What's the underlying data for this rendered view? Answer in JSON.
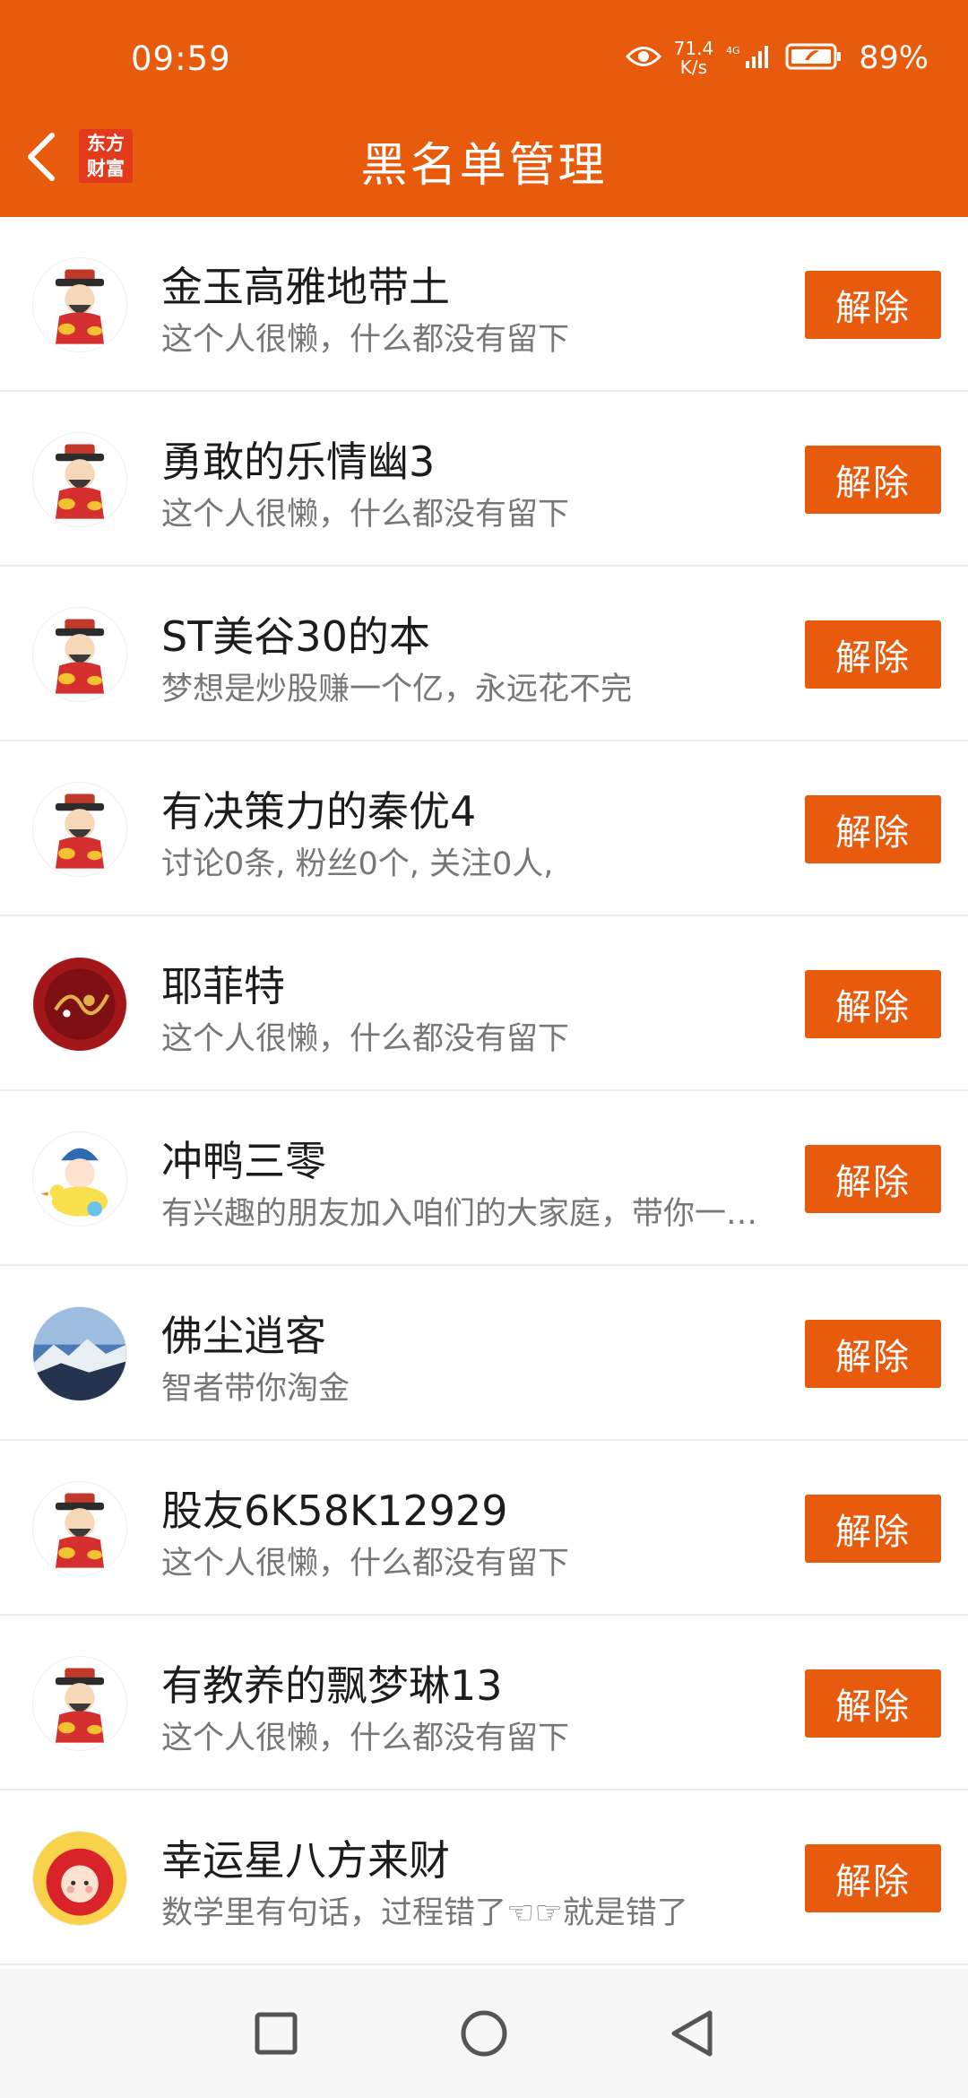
{
  "status_bar": {
    "time": "09:59",
    "net_speed_value": "71.4",
    "net_speed_unit": "K/s",
    "network": "4G",
    "battery": "89%"
  },
  "header": {
    "logo_line1": "东方",
    "logo_line2": "财富",
    "title": "黑名单管理",
    "accent_color": "#e85a0c"
  },
  "users": [
    {
      "name": "金玉高雅地带土",
      "desc": "这个人很懒，什么都没有留下",
      "avatar": "caishen",
      "action": "解除"
    },
    {
      "name": "勇敢的乐情幽3",
      "desc": "这个人很懒，什么都没有留下",
      "avatar": "caishen",
      "action": "解除"
    },
    {
      "name": "ST美谷30的本",
      "desc": "梦想是炒股赚一个亿，永远花不完",
      "avatar": "caishen",
      "action": "解除"
    },
    {
      "name": "有决策力的秦优4",
      "desc": "讨论0条, 粉丝0个, 关注0人,",
      "avatar": "caishen",
      "action": "解除"
    },
    {
      "name": "耶菲特",
      "desc": "这个人很懒，什么都没有留下",
      "avatar": "red-floral",
      "action": "解除"
    },
    {
      "name": "冲鸭三零",
      "desc": "有兴趣的朋友加入咱们的大家庭，带你一起淘金",
      "avatar": "cartoon-duck",
      "action": "解除"
    },
    {
      "name": "佛尘逍客",
      "desc": "智者带你淘金",
      "avatar": "mountain",
      "action": "解除"
    },
    {
      "name": "股友6K58K12929",
      "desc": "这个人很懒，什么都没有留下",
      "avatar": "caishen",
      "action": "解除"
    },
    {
      "name": "有教养的飘梦琳13",
      "desc": "这个人很懒，什么都没有留下",
      "avatar": "caishen",
      "action": "解除"
    },
    {
      "name": "幸运星八方来财",
      "desc": "数学里有句话，过程错了☜☞就是错了",
      "avatar": "red-hood-girl",
      "action": "解除"
    }
  ],
  "nav": {
    "recents_icon": "square-icon",
    "home_icon": "circle-icon",
    "back_icon": "triangle-back-icon"
  }
}
